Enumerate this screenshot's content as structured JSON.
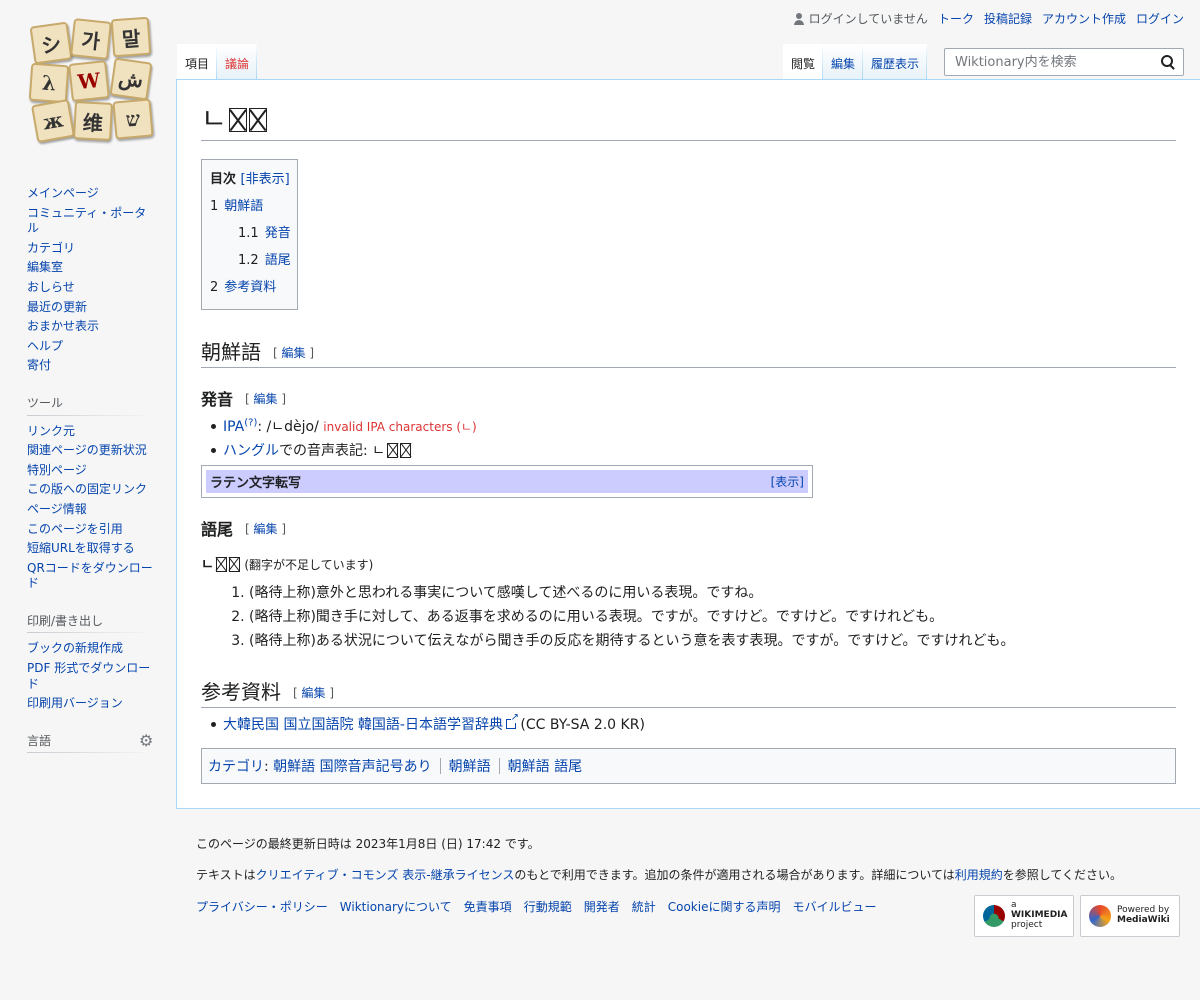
{
  "personal": {
    "not_logged_in": "ログインしていません",
    "talk": "トーク",
    "contributions": "投稿記録",
    "create_account": "アカウント作成",
    "login": "ログイン"
  },
  "logo": {
    "tiles": [
      "シ",
      "가",
      "말",
      "λ",
      "W",
      "ش",
      "ж",
      "维",
      "ש"
    ]
  },
  "sidebar": {
    "nav": [
      "メインページ",
      "コミュニティ・ポータル",
      "カテゴリ",
      "編集室",
      "おしらせ",
      "最近の更新",
      "おまかせ表示",
      "ヘルプ",
      "寄付"
    ],
    "tools_heading": "ツール",
    "tools": [
      "リンク元",
      "関連ページの更新状況",
      "特別ページ",
      "この版への固定リンク",
      "ページ情報",
      "このページを引用",
      "短縮URLを取得する",
      "QRコードをダウンロード"
    ],
    "print_heading": "印刷/書き出し",
    "print": [
      "ブックの新規作成",
      "PDF 形式でダウンロード",
      "印刷用バージョン"
    ],
    "lang_heading": "言語"
  },
  "tabs": {
    "left": [
      "項目",
      "議論"
    ],
    "right": [
      "閲覧",
      "編集",
      "履歴表示"
    ]
  },
  "search": {
    "placeholder": "Wiktionary内を検索"
  },
  "page": {
    "title_prefix": "ㄴ",
    "toc": {
      "title": "目次",
      "toggle": "[非表示]",
      "entries": [
        {
          "num": "1",
          "label": "朝鮮語",
          "level": 1
        },
        {
          "num": "1.1",
          "label": "発音",
          "level": 2
        },
        {
          "num": "1.2",
          "label": "語尾",
          "level": 2
        },
        {
          "num": "2",
          "label": "参考資料",
          "level": 1
        }
      ]
    },
    "edit_label": "編集",
    "h2_korean": "朝鮮語",
    "h3_pron": "発音",
    "pron": {
      "ipa_link": "IPA",
      "ipa_sup": "(?)",
      "ipa_value": ": /ㄴdèjo/",
      "ipa_error": "invalid IPA characters (ㄴ)",
      "hangul_link": "ハングル",
      "hangul_text": "での音声表記: ㄴ"
    },
    "nav_frame": {
      "title": "ラテン文字転写",
      "toggle": "[表示]"
    },
    "h3_ending": "語尾",
    "ending": {
      "headword": "ㄴ",
      "note": "(翻字が不足しています)",
      "defs": [
        "(略待上称)意外と思われる事実について感嘆して述べるのに用いる表現。ですね。",
        "(略待上称)聞き手に対して、ある返事を求めるのに用いる表現。ですが。ですけど。ですけど。ですけれども。",
        "(略待上称)ある状況について伝えながら聞き手の反応を期待するという意を表す表現。ですが。ですけど。ですけれども。"
      ]
    },
    "h2_refs": "参考資料",
    "ref": {
      "link": "大韓民国 国立国語院 韓国語-日本語学習辞典",
      "license": "(CC BY-SA 2.0 KR)"
    },
    "categories": {
      "label": "カテゴリ",
      "items": [
        "朝鮮語 国際音声記号あり",
        "朝鮮語",
        "朝鮮語 語尾"
      ]
    }
  },
  "footer": {
    "last_modified": "このページの最終更新日時は 2023年1月8日 (日) 17:42 です。",
    "license_pre": "テキストは",
    "license_link": "クリエイティブ・コモンズ 表示-継承ライセンス",
    "license_mid": "のもとで利用できます。追加の条件が適用される場合があります。詳細については",
    "terms_link": "利用規約",
    "license_post": "を参照してください。",
    "places": [
      "プライバシー・ポリシー",
      "Wiktionaryについて",
      "免責事項",
      "行動規範",
      "開発者",
      "統計",
      "Cookieに関する声明",
      "モバイルビュー"
    ],
    "wikimedia_badge": [
      "a",
      "WIKIMEDIA",
      "project"
    ],
    "mediawiki_badge": [
      "Powered by",
      "MediaWiki"
    ]
  }
}
